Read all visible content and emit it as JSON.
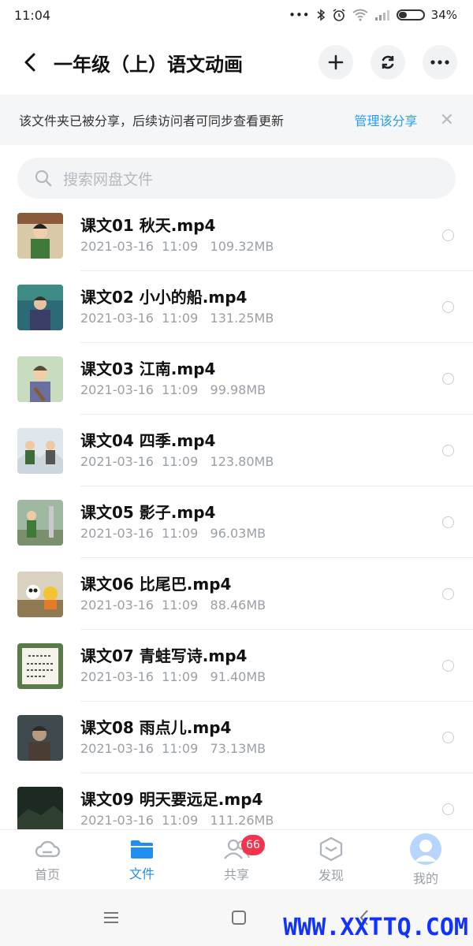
{
  "status": {
    "time": "11:04",
    "battery": "34%",
    "battery_level": 0.34
  },
  "header": {
    "title": "一年级（上）语文动画"
  },
  "share_banner": {
    "text": "该文件夹已被分享，后续访问者可同步查看更新",
    "manage": "管理该分享",
    "close": "✕"
  },
  "search": {
    "placeholder": "搜索网盘文件"
  },
  "files": [
    {
      "name": "课文01 秋天.mp4",
      "meta": "2021-03-16  11:09   109.32MB"
    },
    {
      "name": "课文02 小小的船.mp4",
      "meta": "2021-03-16  11:09   131.25MB"
    },
    {
      "name": "课文03 江南.mp4",
      "meta": "2021-03-16  11:09   99.98MB"
    },
    {
      "name": "课文04 四季.mp4",
      "meta": "2021-03-16  11:09   123.80MB"
    },
    {
      "name": "课文05 影子.mp4",
      "meta": "2021-03-16  11:09   96.03MB"
    },
    {
      "name": "课文06 比尾巴.mp4",
      "meta": "2021-03-16  11:09   88.46MB"
    },
    {
      "name": "课文07 青蛙写诗.mp4",
      "meta": "2021-03-16  11:09   91.40MB"
    },
    {
      "name": "课文08 雨点儿.mp4",
      "meta": "2021-03-16  11:09   73.13MB"
    },
    {
      "name": "课文09 明天要远足.mp4",
      "meta": "2021-03-16  11:09   111.26MB"
    }
  ],
  "tabs": [
    {
      "label": "首页",
      "icon": "cloud-icon"
    },
    {
      "label": "文件",
      "icon": "folder-icon",
      "active": true
    },
    {
      "label": "共享",
      "icon": "people-icon",
      "badge": "66"
    },
    {
      "label": "发现",
      "icon": "cube-icon"
    },
    {
      "label": "我的",
      "icon": "avatar-icon"
    }
  ],
  "watermark": "WWW.XXTTQ.COM",
  "colors": {
    "accent": "#1e8ef0",
    "link": "#2a9df4",
    "badge": "#f3344e",
    "watermark": "#1133ff"
  }
}
